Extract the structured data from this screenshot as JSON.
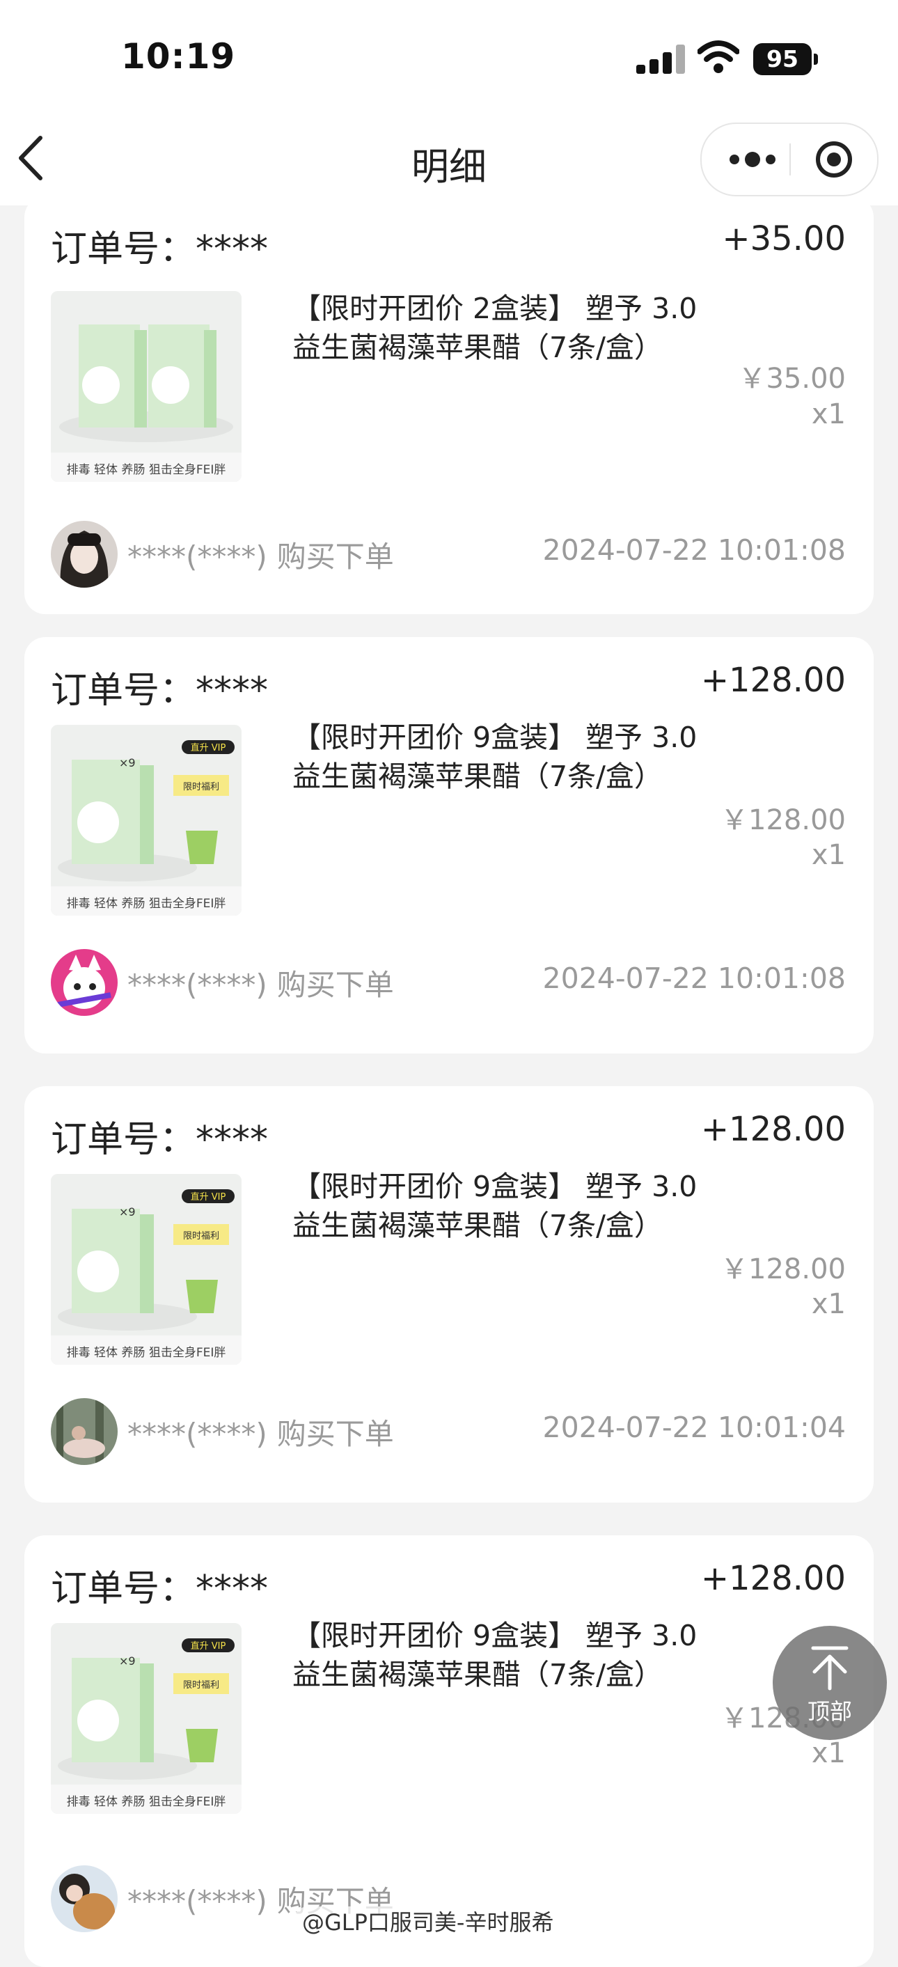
{
  "status_bar": {
    "time": "10:19",
    "battery": "95"
  },
  "nav": {
    "title": "明细"
  },
  "orders": [
    {
      "order_label": "订单号：****",
      "amount": "+35.00",
      "product_name": "【限时开团价 2盒装】 塑予 3.0益生菌褐藻苹果醋（7条/盒）",
      "thumb_caption": "排毒 轻体 养肠 狙击全身FEI胖",
      "price": "￥35.00",
      "qty": "x1",
      "buyer": "****(****)",
      "action": "购买下单",
      "date": "2024-07-22 10:01:08"
    },
    {
      "order_label": "订单号：****",
      "amount": "+128.00",
      "product_name": "【限时开团价 9盒装】 塑予 3.0益生菌褐藻苹果醋（7条/盒）",
      "thumb_caption": "排毒 轻体 养肠 狙击全身FEI胖",
      "thumb_badge": "直升 VIP",
      "thumb_tag": "限时福利",
      "thumb_count": "×9",
      "price": "￥128.00",
      "qty": "x1",
      "buyer": "****(****)",
      "action": "购买下单",
      "date": "2024-07-22 10:01:08"
    },
    {
      "order_label": "订单号：****",
      "amount": "+128.00",
      "product_name": "【限时开团价 9盒装】 塑予 3.0益生菌褐藻苹果醋（7条/盒）",
      "thumb_caption": "排毒 轻体 养肠 狙击全身FEI胖",
      "thumb_badge": "直升 VIP",
      "thumb_tag": "限时福利",
      "thumb_count": "×9",
      "price": "￥128.00",
      "qty": "x1",
      "buyer": "****(****)",
      "action": "购买下单",
      "date": "2024-07-22 10:01:04"
    },
    {
      "order_label": "订单号：****",
      "amount": "+128.00",
      "product_name": "【限时开团价 9盒装】 塑予 3.0益生菌褐藻苹果醋（7条/盒）",
      "thumb_caption": "排毒 轻体 养肠 狙击全身FEI胖",
      "thumb_badge": "直升 VIP",
      "thumb_tag": "限时福利",
      "thumb_count": "×9",
      "price": "￥128.00",
      "qty": "x1",
      "buyer": "****(****)",
      "action": "购买下单",
      "date": ""
    }
  ],
  "to_top": {
    "label": "顶部",
    "icon": "arrow-up-to-top-icon"
  },
  "watermark": "@GLP口服司美-辛时服希",
  "colors": {
    "background": "#f3f3f3",
    "card": "#ffffff",
    "muted_text": "#999999",
    "product_green": "#8fd28a"
  }
}
